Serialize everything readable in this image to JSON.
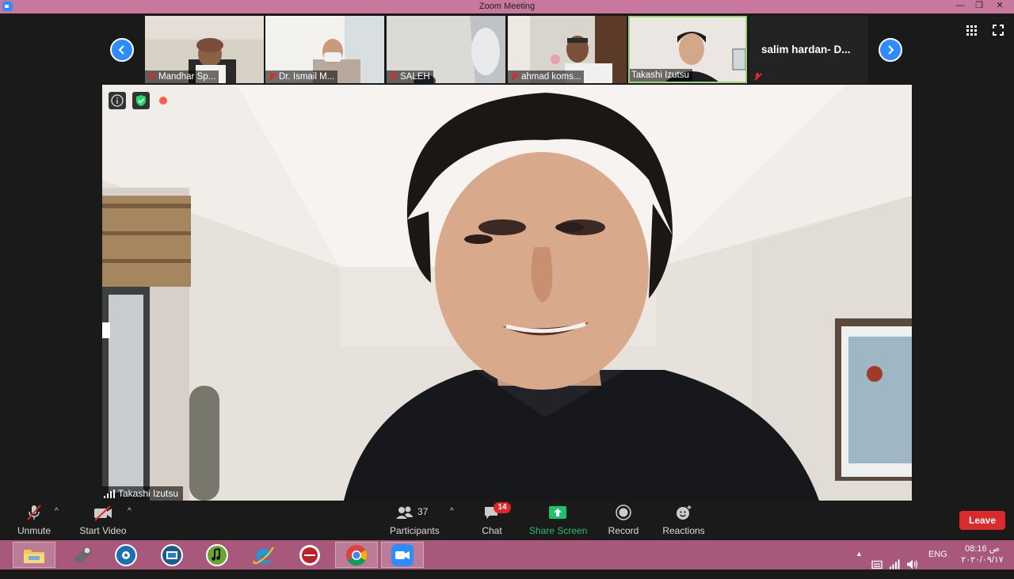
{
  "window": {
    "title": "Zoom Meeting"
  },
  "thumbnails": [
    {
      "name": "Mandhar Sp..."
    },
    {
      "name": "Dr. Ismail M..."
    },
    {
      "name": "SALEH"
    },
    {
      "name": "ahmad koms..."
    },
    {
      "name": "Takashi Izutsu"
    },
    {
      "name": "salim  hardan- D..."
    }
  ],
  "main": {
    "recording_label": "Recording",
    "speaker_name": "Takashi Izutsu"
  },
  "toolbar": {
    "unmute": "Unmute",
    "start_video": "Start Video",
    "participants": "Participants",
    "participants_count": "37",
    "chat": "Chat",
    "chat_badge": "14",
    "share_screen": "Share Screen",
    "record": "Record",
    "reactions": "Reactions",
    "leave": "Leave"
  },
  "taskbar": {
    "language": "ENG",
    "time": "08:16 ص",
    "date": "٢٠٢٠/٠٩/١٧"
  },
  "colors": {
    "accent_blue": "#2d8cff",
    "share_green": "#1fc26b",
    "leave_red": "#d92b2b",
    "title_bar": "#c8789e",
    "taskbar": "#a8587a"
  }
}
